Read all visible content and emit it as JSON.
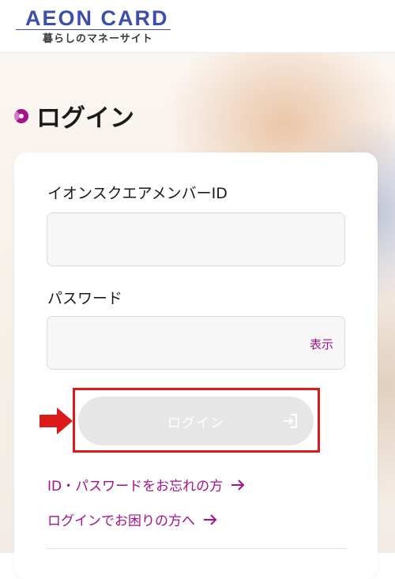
{
  "header": {
    "logo_main": "AEON CARD",
    "logo_sub": "暮らしのマネーサイト"
  },
  "page": {
    "title": "ログイン"
  },
  "form": {
    "member_id_label": "イオンスクエアメンバーID",
    "member_id_value": "",
    "password_label": "パスワード",
    "password_value": "",
    "show_password_label": "表示",
    "login_button_label": "ログイン",
    "login_button_state": "disabled"
  },
  "links": {
    "forgot": "ID・パスワードをお忘れの方",
    "trouble": "ログインでお困りの方へ"
  },
  "colors": {
    "brand": "#3d4fa8",
    "accent": "#a3128a",
    "highlight_annotation": "#dd1a1a",
    "disabled_button": "#e6e6e6"
  },
  "icons": {
    "title_marker": "ring-icon",
    "login_button": "enter-icon",
    "links": "arrow-right-icon",
    "annotation": "red-arrow-icon"
  }
}
